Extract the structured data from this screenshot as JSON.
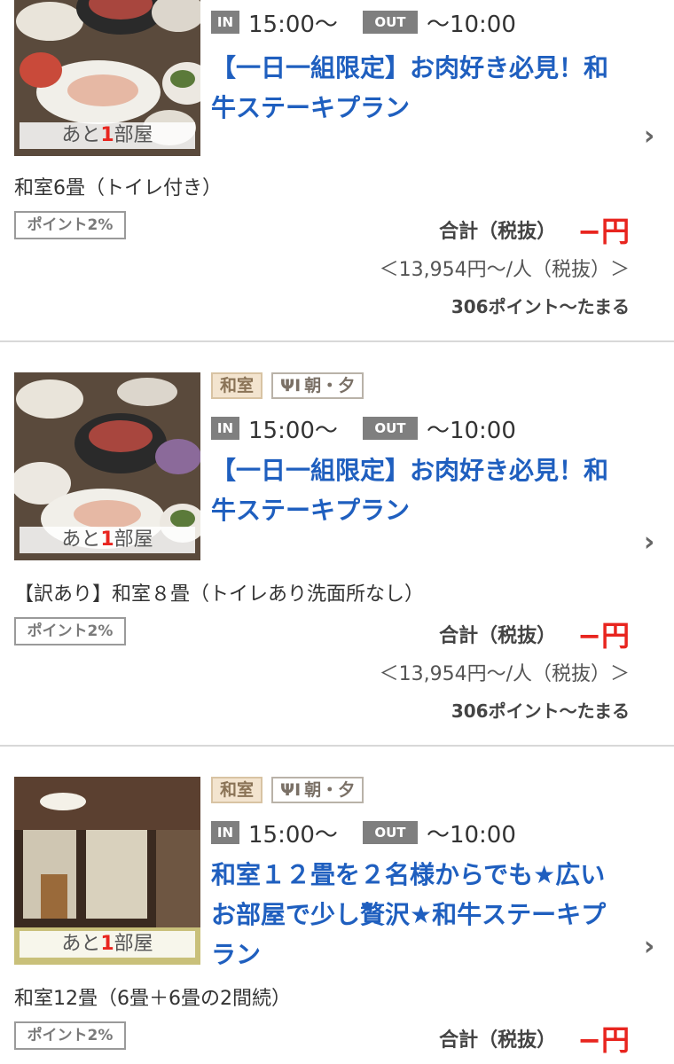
{
  "colors": {
    "title": "#1f5fbf",
    "price": "#e8251f",
    "badge": "#7f7f7f",
    "room_tag_bg": "#f3e4cf"
  },
  "plans": [
    {
      "image": "kaiseki-meal-photo",
      "rooms_left_prefix": "あと",
      "rooms_left_num": "1",
      "rooms_left_suffix": "部屋",
      "checkin_label": "IN",
      "checkin": "15:00〜",
      "checkout_label": "OUT",
      "checkout": "〜10:00",
      "title_line1": "【一日一組限定】お肉好き必見！和",
      "title_line2": "牛ステーキプラン",
      "room": "和室6畳（トイレ付き）",
      "points_badge": "ポイント2%",
      "total_label": "合計（税抜）",
      "total_price": "−円",
      "per_person": "＜13,954円〜/人（税抜）＞",
      "earn": "306ポイント〜たまる"
    },
    {
      "image": "kaiseki-meal-photo",
      "tag_room": "和室",
      "tag_meal": "朝・夕",
      "rooms_left_prefix": "あと",
      "rooms_left_num": "1",
      "rooms_left_suffix": "部屋",
      "checkin_label": "IN",
      "checkin": "15:00〜",
      "checkout_label": "OUT",
      "checkout": "〜10:00",
      "title_line1": "【一日一組限定】お肉好き必見！和",
      "title_line2": "牛ステーキプラン",
      "room": "【訳あり】和室８畳（トイレあり洗面所なし）",
      "points_badge": "ポイント2%",
      "total_label": "合計（税抜）",
      "total_price": "−円",
      "per_person": "＜13,954円〜/人（税抜）＞",
      "earn": "306ポイント〜たまる"
    },
    {
      "image": "japanese-room-photo",
      "tag_room": "和室",
      "tag_meal": "朝・夕",
      "rooms_left_prefix": "あと",
      "rooms_left_num": "1",
      "rooms_left_suffix": "部屋",
      "checkin_label": "IN",
      "checkin": "15:00〜",
      "checkout_label": "OUT",
      "checkout": "〜10:00",
      "title_line1": "和室１２畳を２名様からでも★広い",
      "title_line2": "お部屋で少し贅沢★和牛ステーキプ",
      "title_line3": "ラン",
      "room": "和室12畳（6畳＋6畳の2間続）",
      "points_badge": "ポイント2%",
      "total_label": "合計（税抜）",
      "total_price": "−円"
    }
  ]
}
